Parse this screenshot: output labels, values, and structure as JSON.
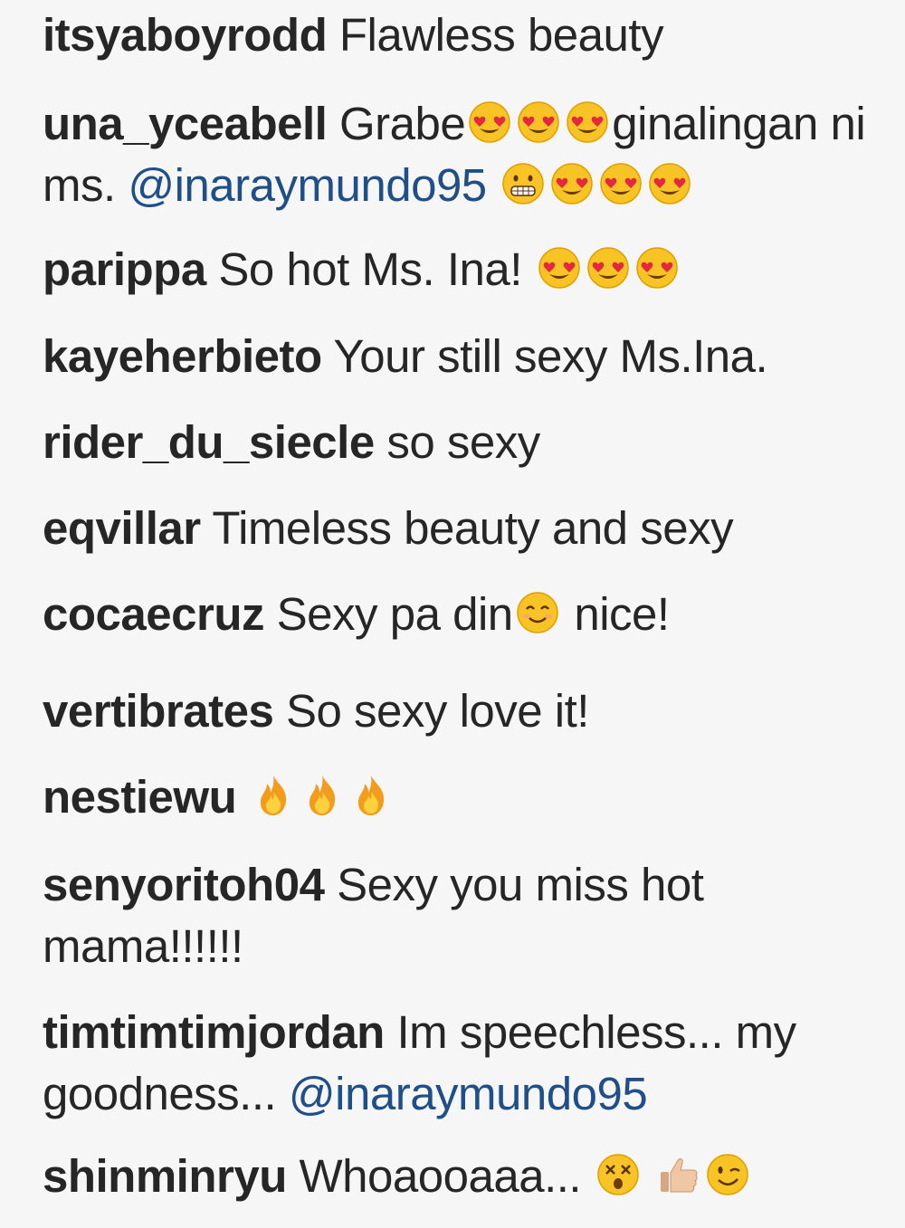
{
  "comments": [
    {
      "user": "itsyaboyrodd",
      "parts": [
        {
          "type": "text",
          "text": "Flawless beauty"
        }
      ]
    },
    {
      "user": "una_yceabell",
      "parts": [
        {
          "type": "text",
          "text": "Grabe"
        },
        {
          "type": "emoji",
          "icon": "heart-eyes"
        },
        {
          "type": "emoji",
          "icon": "heart-eyes"
        },
        {
          "type": "emoji",
          "icon": "heart-eyes"
        },
        {
          "type": "text",
          "text": "ginalingan ni ms. "
        },
        {
          "type": "mention",
          "text": "@inaraymundo95"
        },
        {
          "type": "text",
          "text": " "
        },
        {
          "type": "emoji",
          "icon": "grimace"
        },
        {
          "type": "emoji",
          "icon": "heart-eyes"
        },
        {
          "type": "emoji",
          "icon": "heart-eyes"
        },
        {
          "type": "emoji",
          "icon": "heart-eyes"
        }
      ]
    },
    {
      "user": "parippa",
      "parts": [
        {
          "type": "text",
          "text": "So hot Ms. Ina! "
        },
        {
          "type": "emoji",
          "icon": "heart-eyes"
        },
        {
          "type": "emoji",
          "icon": "heart-eyes"
        },
        {
          "type": "emoji",
          "icon": "heart-eyes"
        }
      ]
    },
    {
      "user": "kayeherbieto",
      "parts": [
        {
          "type": "text",
          "text": "Your still sexy Ms.Ina."
        }
      ]
    },
    {
      "user": "rider_du_siecle",
      "parts": [
        {
          "type": "text",
          "text": "so sexy"
        }
      ]
    },
    {
      "user": "eqvillar",
      "parts": [
        {
          "type": "text",
          "text": "Timeless beauty and sexy"
        }
      ]
    },
    {
      "user": "cocaecruz",
      "parts": [
        {
          "type": "text",
          "text": "Sexy pa din"
        },
        {
          "type": "emoji",
          "icon": "smile"
        },
        {
          "type": "text",
          "text": " nice!"
        }
      ]
    },
    {
      "user": "vertibrates",
      "parts": [
        {
          "type": "text",
          "text": "So sexy love it!"
        }
      ]
    },
    {
      "user": "nestiewu",
      "parts": [
        {
          "type": "text",
          "text": " "
        },
        {
          "type": "emoji",
          "icon": "fire"
        },
        {
          "type": "emoji",
          "icon": "fire"
        },
        {
          "type": "emoji",
          "icon": "fire"
        }
      ]
    },
    {
      "user": "senyoritoh04",
      "parts": [
        {
          "type": "text",
          "text": "Sexy you miss hot mama!!!!!!"
        }
      ]
    },
    {
      "user": "timtimtimjordan",
      "parts": [
        {
          "type": "text",
          "text": "Im speechless... my goodness... "
        },
        {
          "type": "mention",
          "text": "@inaraymundo95"
        }
      ]
    },
    {
      "user": "shinminryu",
      "parts": [
        {
          "type": "text",
          "text": "Whoaooaaa... "
        },
        {
          "type": "emoji",
          "icon": "dizzy-face"
        },
        {
          "type": "text",
          "text": " "
        },
        {
          "type": "emoji",
          "icon": "thumbs-up"
        },
        {
          "type": "emoji",
          "icon": "wink"
        }
      ]
    }
  ],
  "colors": {
    "background": "#f6f6f6",
    "text": "#262626",
    "mention": "#1f4f88"
  }
}
